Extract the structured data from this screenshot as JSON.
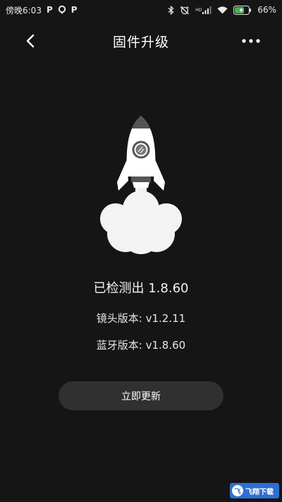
{
  "status_bar": {
    "time": "傍晚6:03",
    "notif_glyphs": [
      "P",
      "P"
    ],
    "battery": "66%",
    "network_label": "HD"
  },
  "header": {
    "title": "固件升级"
  },
  "firmware": {
    "detected": "已检测出 1.8.60",
    "lens": "镜头版本: v1.2.11",
    "bluetooth": "蓝牙版本: v1.8.60"
  },
  "actions": {
    "update_label": "立即更新"
  },
  "watermark": {
    "text": "飞翔下载"
  },
  "colors": {
    "background": "#151515",
    "button": "#303030",
    "battery_accent": "#4caf50"
  }
}
